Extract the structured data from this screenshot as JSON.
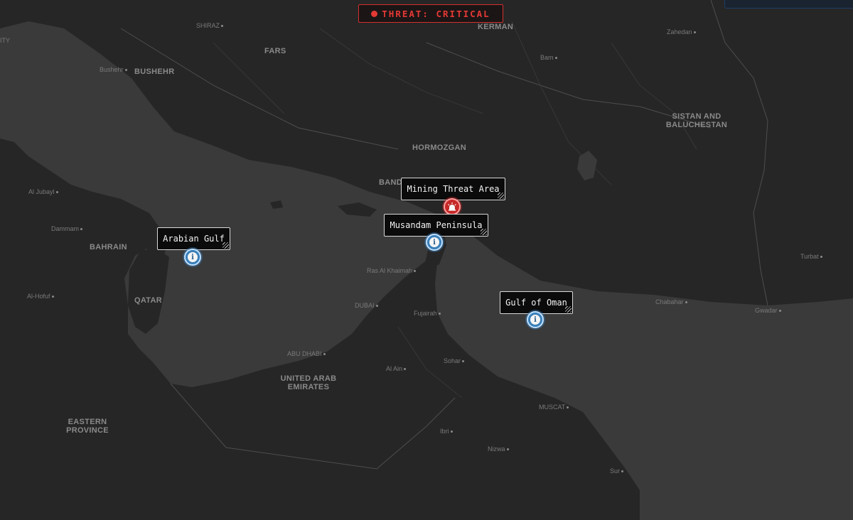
{
  "threat": {
    "label": "THREAT: CRITICAL",
    "color": "#e53935"
  },
  "regions": {
    "fars": "FARS",
    "kerman": "KERMAN",
    "bushehr": "BUSHEHR",
    "hormozgan": "HORMOZGAN",
    "sistan": "SISTAN AND BALUCHESTAN",
    "bahrain": "BAHRAIN",
    "qatar": "QATAR",
    "uae": "UNITED ARAB EMIRATES",
    "eastern": "EASTERN PROVINCE",
    "bandar": "BANDAR"
  },
  "places": {
    "shiraz": "SHIRAZ",
    "zahedan": "Zahedan",
    "bam": "Bam",
    "bushehr": "Bushehr",
    "aljubayl": "Al Jubayl",
    "dammam": "Dammam",
    "alhofuf": "Al-Hofuf",
    "raskhaimah": "Ras Al Khaimah",
    "dubai": "DUBAI",
    "fujairah": "Fujairah",
    "abudhabi": "ABU DHABI",
    "alain": "Al Ain",
    "sohar": "Sohar",
    "muscat": "MUSCAT",
    "ibri": "Ibri",
    "nizwa": "Nizwa",
    "sur": "Sur",
    "chabahar": "Chabahar",
    "gwadar": "Gwadar",
    "turbat": "Turbat",
    "ity": "ITY"
  },
  "callouts": {
    "arabian_gulf": "Arabian Gulf",
    "mining_threat": "Mining Threat Area",
    "musandam": "Musandam Peninsula",
    "gulf_of_oman": "Gulf of Oman"
  },
  "markers": {
    "info_glyph": "i",
    "info_icon": "info-icon",
    "danger_icon": "alarm-icon"
  },
  "colors": {
    "land": "#262626",
    "water": "#3a3a3a",
    "border": "#555555",
    "info": "#3a7fb8",
    "danger": "#c62828"
  }
}
